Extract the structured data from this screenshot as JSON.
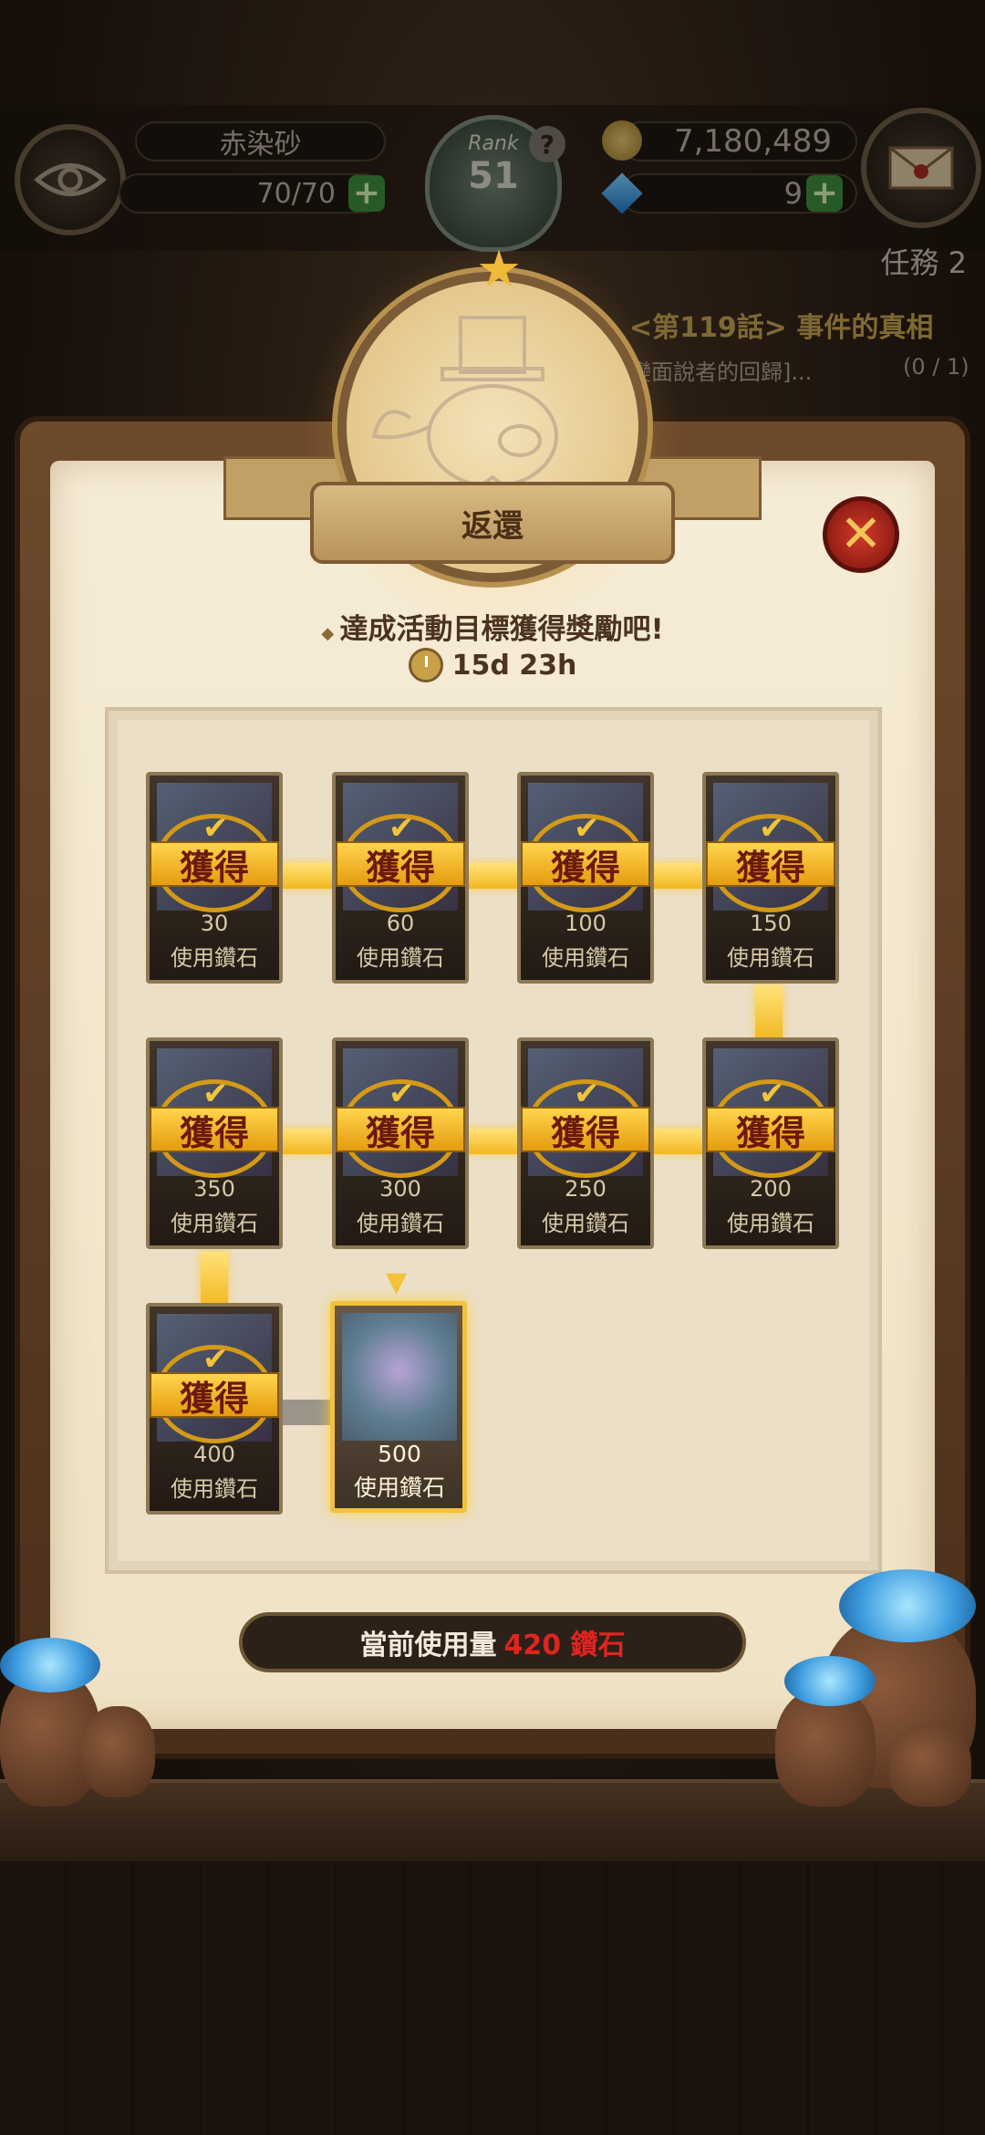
{
  "hud": {
    "player_name": "赤染砂",
    "stamina": "70/70",
    "rank_label": "Rank",
    "rank_value": "51",
    "gold": "7,180,489",
    "gems": "9",
    "quest_tab": "任務 2",
    "quest_title": "<第119話> 事件的真相",
    "quest_subtitle": "變面說者的回歸]...",
    "quest_progress": "(0 / 1)"
  },
  "panel": {
    "title": "返還",
    "goal_text": "達成活動目標獲得獎勵吧!",
    "timer": "15d 23h",
    "claimed_stamp": "獲得",
    "usage_label": "當前使用量",
    "usage_value": "420 鑽石"
  },
  "rewards": [
    {
      "amount": "30",
      "label": "使用鑽石",
      "status": "claimed"
    },
    {
      "amount": "60",
      "label": "使用鑽石",
      "status": "claimed"
    },
    {
      "amount": "100",
      "label": "使用鑽石",
      "status": "claimed"
    },
    {
      "amount": "150",
      "label": "使用鑽石",
      "status": "claimed"
    },
    {
      "amount": "200",
      "label": "使用鑽石",
      "status": "claimed"
    },
    {
      "amount": "250",
      "label": "使用鑽石",
      "status": "claimed"
    },
    {
      "amount": "300",
      "label": "使用鑽石",
      "status": "claimed"
    },
    {
      "amount": "350",
      "label": "使用鑽石",
      "status": "claimed"
    },
    {
      "amount": "400",
      "label": "使用鑽石",
      "status": "claimed"
    },
    {
      "amount": "500",
      "label": "使用鑽石",
      "status": "current"
    }
  ],
  "colors": {
    "accent_gold": "#f3b71f",
    "usage_red": "#e0241f",
    "close_red": "#d23b2b"
  },
  "icons": [
    "eye-icon",
    "mail-icon",
    "coin-icon",
    "gem-icon",
    "help-icon",
    "clock-icon",
    "close-icon",
    "check-icon",
    "star-icon"
  ]
}
